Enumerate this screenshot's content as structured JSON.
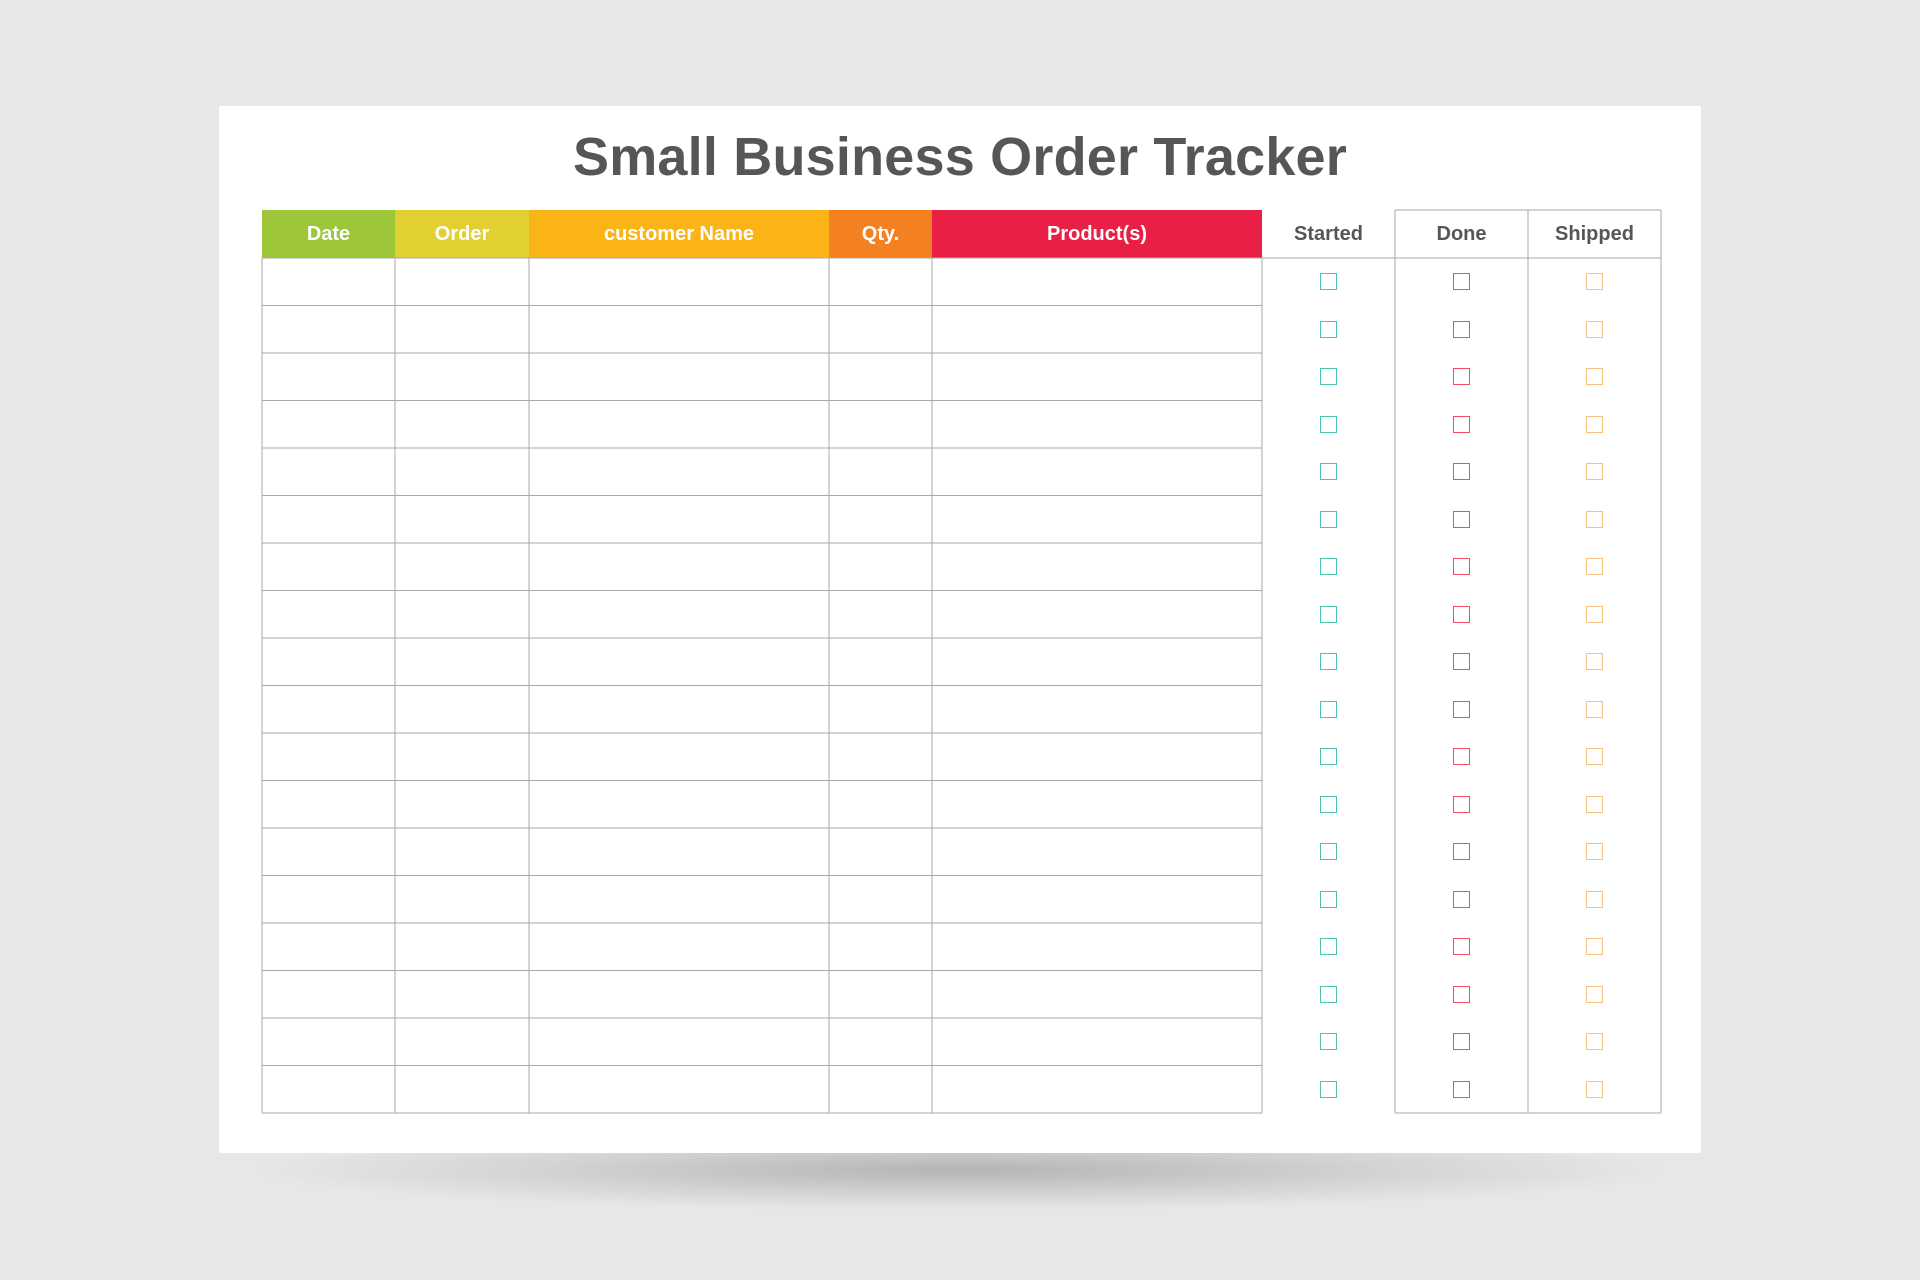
{
  "title": "Small Business Order Tracker",
  "columns": [
    {
      "label": "Date",
      "color": "#9dc63b"
    },
    {
      "label": "Order",
      "color": "#e2cf31"
    },
    {
      "label": "customer Name",
      "color": "#fbb416"
    },
    {
      "label": "Qty.",
      "color": "#f38021"
    },
    {
      "label": "Product(s)",
      "color": "#ea1f46"
    }
  ],
  "status_columns": [
    {
      "label": "Started",
      "color": "#4fc1b0"
    },
    {
      "label": "Done",
      "color": "#ec5060"
    },
    {
      "label": "Shipped",
      "color": "#f9c280"
    }
  ],
  "row_count": 18,
  "rows": []
}
